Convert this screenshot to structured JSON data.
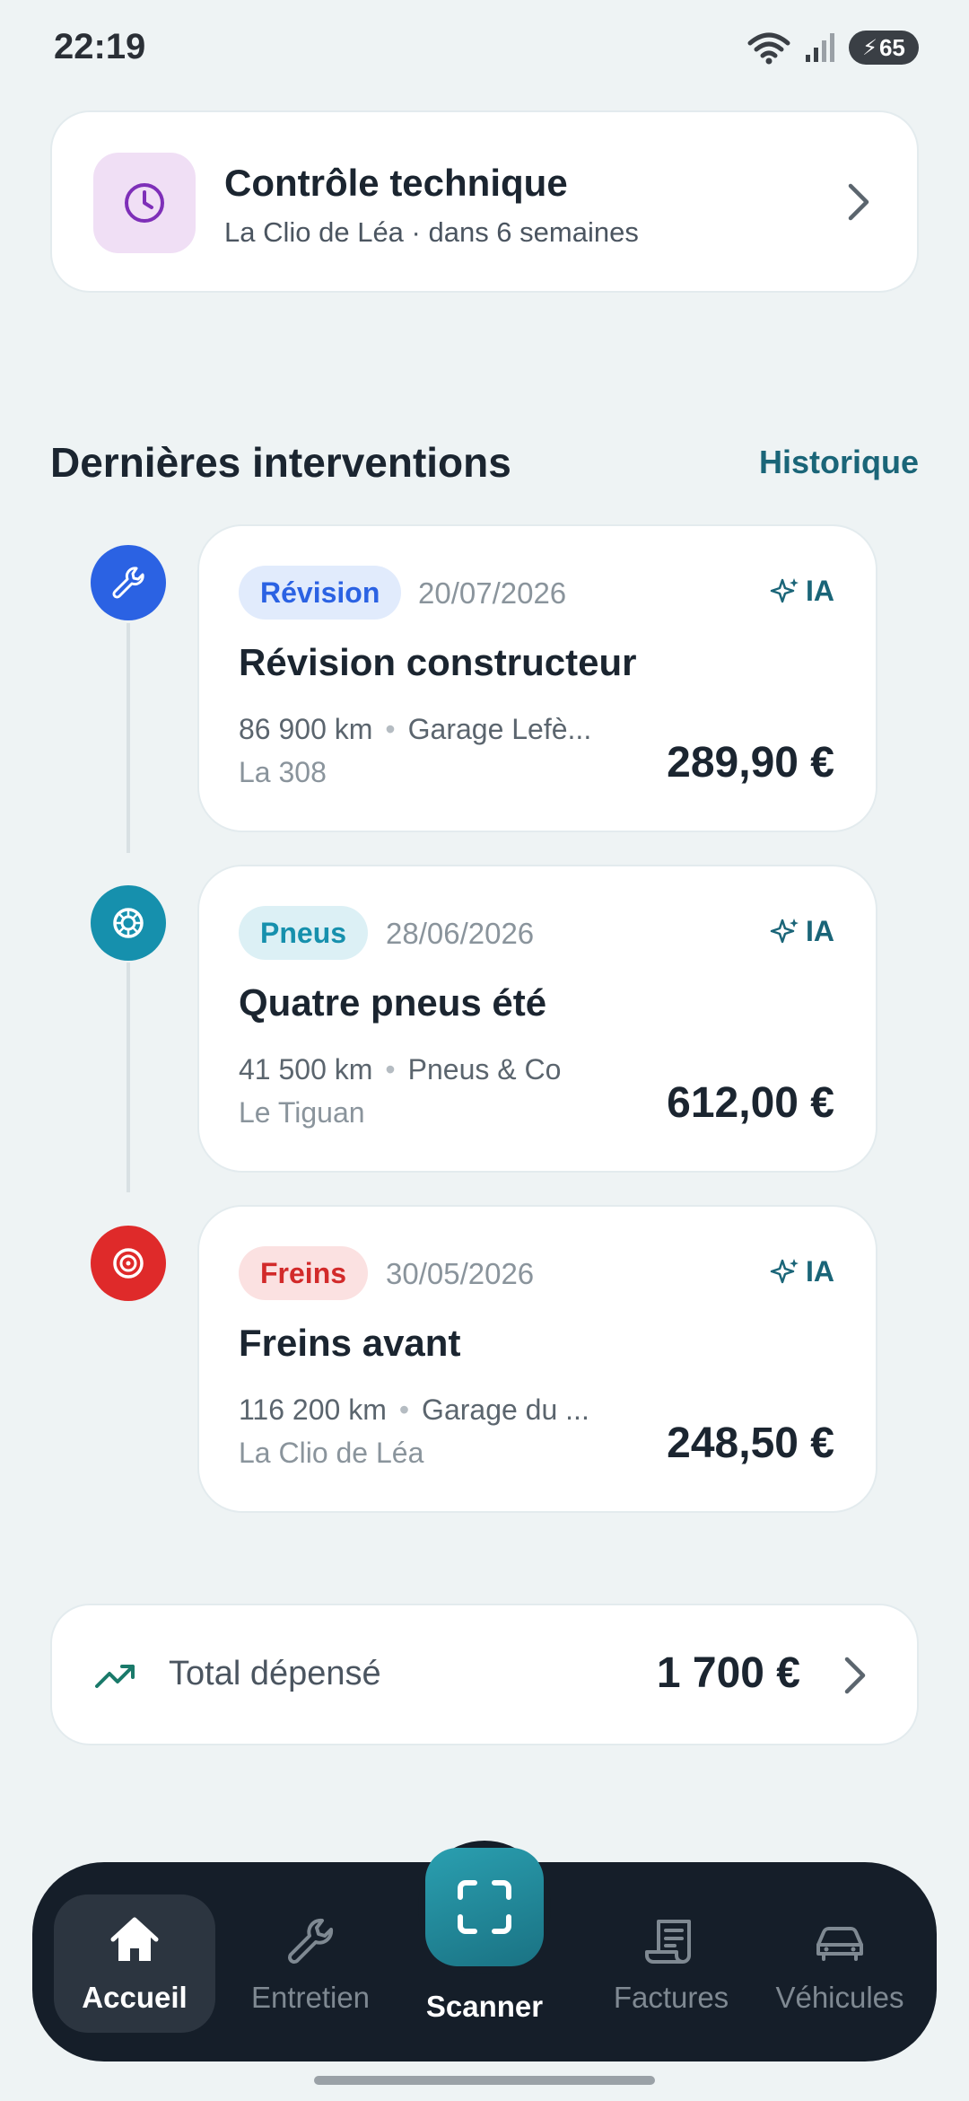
{
  "status_bar": {
    "time": "22:19",
    "battery": "65"
  },
  "reminder": {
    "title": "Contrôle technique",
    "subtitle": "La Clio de Léa · dans 6 semaines",
    "icon": "clock-icon"
  },
  "section": {
    "title": "Dernières interventions",
    "link": "Historique"
  },
  "interventions": [
    {
      "category": "Révision",
      "date": "20/07/2026",
      "ai_tag": "IA",
      "title": "Révision constructeur",
      "km": "86 900 km",
      "garage": "Garage Lefè...",
      "vehicle": "La 308",
      "price": "289,90 €",
      "icon": "wrench-icon",
      "color": "#2b62e3"
    },
    {
      "category": "Pneus",
      "date": "28/06/2026",
      "ai_tag": "IA",
      "title": "Quatre pneus été",
      "km": "41 500 km",
      "garage": "Pneus & Co",
      "vehicle": "Le Tiguan",
      "price": "612,00 €",
      "icon": "tire-icon",
      "color": "#1690ad"
    },
    {
      "category": "Freins",
      "date": "30/05/2026",
      "ai_tag": "IA",
      "title": "Freins avant",
      "km": "116 200 km",
      "garage": "Garage du ...",
      "vehicle": "La Clio de Léa",
      "price": "248,50 €",
      "icon": "brake-icon",
      "color": "#df2a2a"
    }
  ],
  "total": {
    "label": "Total dépensé",
    "value": "1 700 €",
    "icon": "trend-up-icon"
  },
  "nav": {
    "home": "Accueil",
    "maintenance": "Entretien",
    "scanner": "Scanner",
    "invoices": "Factures",
    "vehicles": "Véhicules",
    "active": "Accueil"
  }
}
